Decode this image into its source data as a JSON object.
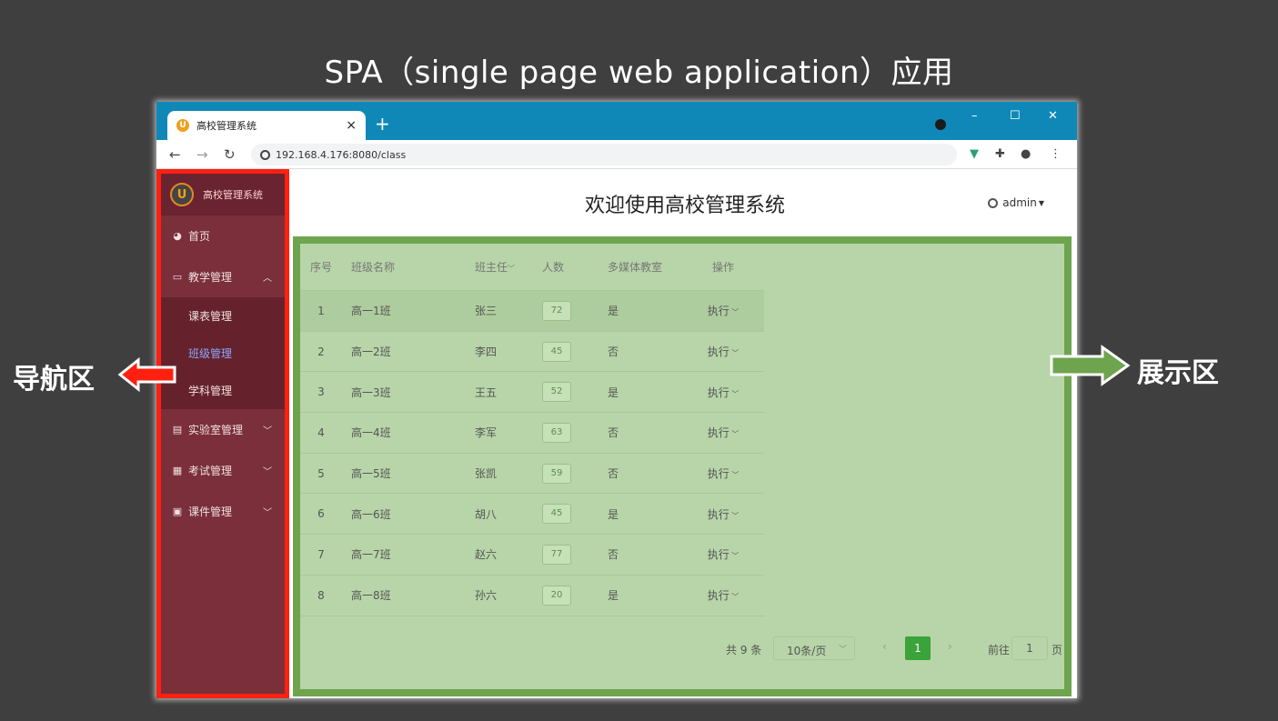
{
  "slide_title": "SPA（single page web application）应用",
  "browser": {
    "tab_title": "高校管理系统",
    "tab_close": "×",
    "new_tab": "+",
    "url": "192.168.4.176:8080/class",
    "window_controls": [
      "–",
      "☐",
      "✕"
    ]
  },
  "sidebar": {
    "brand": "高校管理系统",
    "logo_letter": "U",
    "items": [
      {
        "label": "首页",
        "icon": "dashboard-icon"
      },
      {
        "label": "教学管理",
        "icon": "monitor-icon",
        "expanded": true,
        "children": [
          {
            "label": "课表管理",
            "active": false
          },
          {
            "label": "班级管理",
            "active": true
          },
          {
            "label": "学科管理",
            "active": false
          }
        ]
      },
      {
        "label": "实验室管理",
        "icon": "lab-icon",
        "expanded": false
      },
      {
        "label": "考试管理",
        "icon": "exam-icon",
        "expanded": false
      },
      {
        "label": "课件管理",
        "icon": "courseware-icon",
        "expanded": false
      }
    ]
  },
  "header": {
    "welcome": "欢迎使用高校管理系统",
    "user": "admin"
  },
  "table": {
    "columns": [
      "序号",
      "班级名称",
      "班主任",
      "人数",
      "多媒体教室",
      "操作"
    ],
    "rows": [
      {
        "no": "1",
        "name": "高一1班",
        "teacher": "张三",
        "count": "72",
        "media": "是",
        "action": "执行"
      },
      {
        "no": "2",
        "name": "高一2班",
        "teacher": "李四",
        "count": "45",
        "media": "否",
        "action": "执行"
      },
      {
        "no": "3",
        "name": "高一3班",
        "teacher": "王五",
        "count": "52",
        "media": "是",
        "action": "执行"
      },
      {
        "no": "4",
        "name": "高一4班",
        "teacher": "李军",
        "count": "63",
        "media": "否",
        "action": "执行"
      },
      {
        "no": "5",
        "name": "高一5班",
        "teacher": "张凯",
        "count": "59",
        "media": "否",
        "action": "执行"
      },
      {
        "no": "6",
        "name": "高一6班",
        "teacher": "胡八",
        "count": "45",
        "media": "是",
        "action": "执行"
      },
      {
        "no": "7",
        "name": "高一7班",
        "teacher": "赵六",
        "count": "77",
        "media": "否",
        "action": "执行"
      },
      {
        "no": "8",
        "name": "高一8班",
        "teacher": "孙六",
        "count": "20",
        "media": "是",
        "action": "执行"
      }
    ]
  },
  "pager": {
    "total": "共 9 条",
    "page_size": "10条/页",
    "current_page": "1",
    "goto_label": "前往",
    "goto_value": "1",
    "page_unit": "页"
  },
  "annotations": {
    "left_label": "导航区",
    "right_label": "展示区",
    "left_color": "#ff2010",
    "right_color": "#6fa44f"
  }
}
